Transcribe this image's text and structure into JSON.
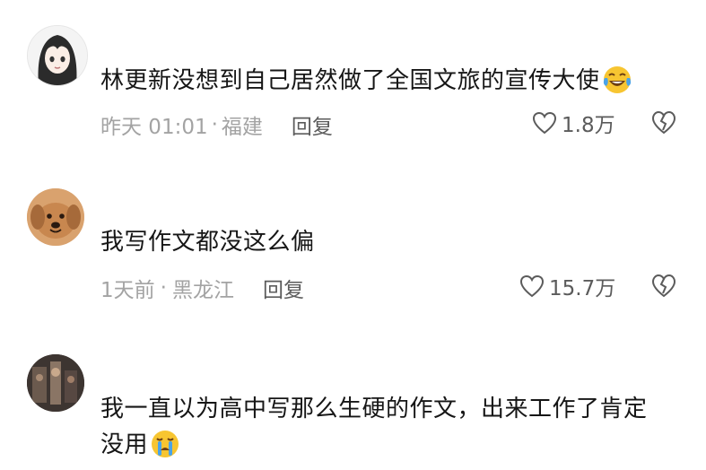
{
  "comments": [
    {
      "avatar": "anime-girl-avatar",
      "text": "林更新没想到自己居然做了全国文旅的宣传大使",
      "emoji": "laughing-crying-emoji",
      "time": "昨天 01:01",
      "location": "福建",
      "reply_label": "回复",
      "likes": "1.8万"
    },
    {
      "avatar": "puppy-avatar",
      "text": "我写作文都没这么偏",
      "time": "1天前",
      "location": "黑龙江",
      "reply_label": "回复",
      "likes": "15.7万"
    },
    {
      "avatar": "dark-photo-avatar",
      "text": "我一直以为高中写那么生硬的作文，出来工作了肯定没用",
      "emoji": "crying-emoji"
    }
  ],
  "colors": {
    "text": "#161616",
    "meta": "#a3a3a3",
    "action": "#5b5b5b",
    "emoji_yellow": "#f7c531"
  }
}
